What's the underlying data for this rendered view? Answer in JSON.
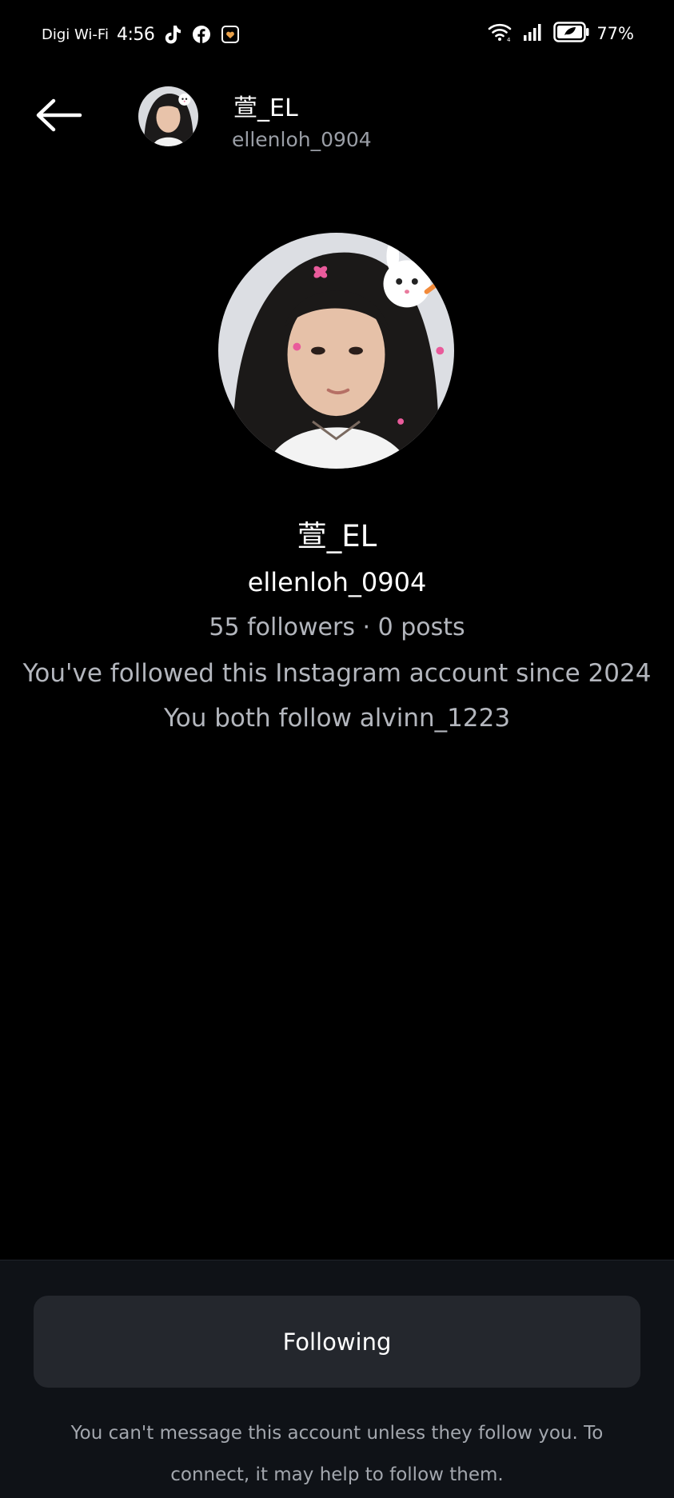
{
  "status_bar": {
    "carrier": "Digi Wi-Fi",
    "time": "4:56",
    "battery": "77%",
    "icons": [
      "tiktok-icon",
      "facebook-icon",
      "app-notification-icon",
      "wifi-icon",
      "signal-icon",
      "battery-icon"
    ]
  },
  "header": {
    "display_name": "萱_EL",
    "username": "ellenloh_0904"
  },
  "profile": {
    "display_name": "萱_EL",
    "username": "ellenloh_0904",
    "stats": "55 followers · 0 posts",
    "follow_since": "You've followed this Instagram account since 2024",
    "mutual": "You both follow alvinn_1223"
  },
  "actions": {
    "following_label": "Following",
    "notice": "You can't message this account unless they follow you. To connect, it may help to follow them."
  },
  "colors": {
    "background": "#000000",
    "panel": "#0f1217",
    "button": "#24272d",
    "secondary_text": "#b3b6bd"
  }
}
